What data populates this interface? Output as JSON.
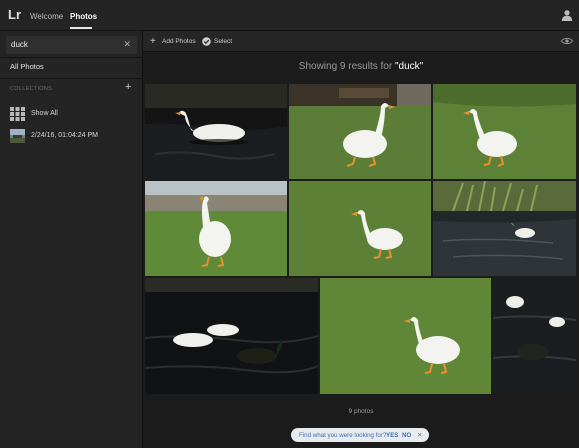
{
  "app": {
    "logo": "Lr",
    "nav": {
      "welcome": "Welcome",
      "photos": "Photos"
    }
  },
  "sidebar": {
    "search": {
      "value": "duck",
      "clear": "✕"
    },
    "all_photos": "All Photos",
    "collections_heading": "COLLECTIONS",
    "add_collection": "+",
    "collections": [
      {
        "label": "Show All",
        "icon": "grid-icon"
      },
      {
        "label": "2/24/16, 01:04:24 PM",
        "icon": "collection-thumbnail-icon"
      }
    ]
  },
  "toolbar": {
    "add_photos_icon": "+",
    "add_photos": "Add Photos",
    "select": "Select"
  },
  "results": {
    "prefix": "Showing 9 results for ",
    "query": "\"duck\"",
    "count": "9 photos"
  },
  "photos": [
    {
      "subject": "white duck swimming on dark water"
    },
    {
      "subject": "white duck walking on grass near benches"
    },
    {
      "subject": "white duck standing on grass"
    },
    {
      "subject": "white duck standing on park lawn"
    },
    {
      "subject": "white duck on grass"
    },
    {
      "subject": "white duck on pond with reeds"
    },
    {
      "subject": "white ducks and mallard on dark water"
    },
    {
      "subject": "white duck walking on grass"
    },
    {
      "subject": "ducks on dark water"
    }
  ],
  "feedback": {
    "question": "Find what you were looking for?",
    "yes": "YES",
    "no": "NO",
    "close": "✕"
  }
}
